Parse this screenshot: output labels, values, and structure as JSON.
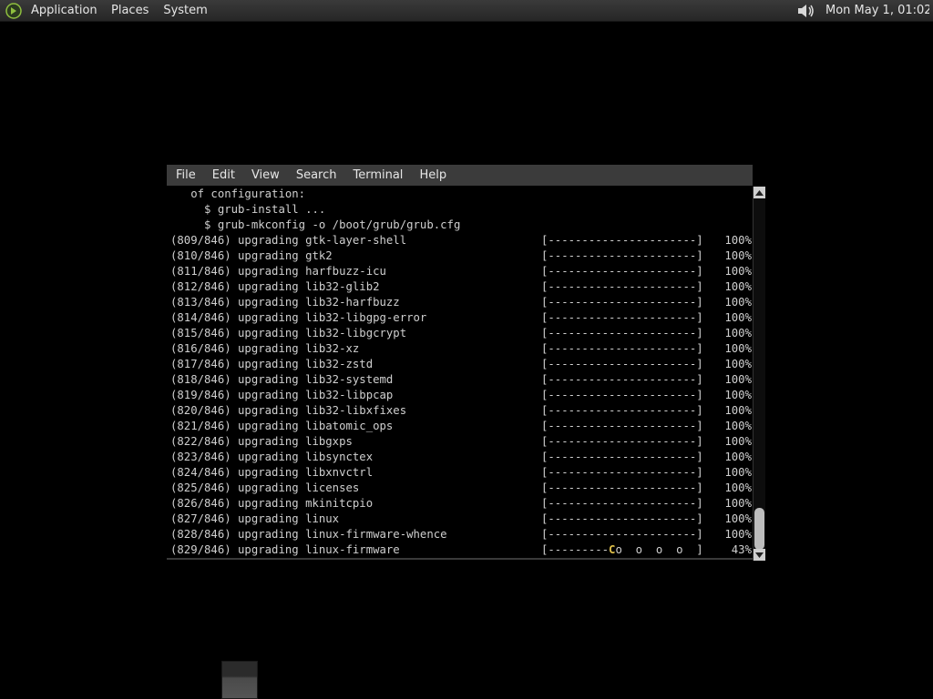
{
  "top_panel": {
    "menus": [
      "Applications",
      "Places",
      "System"
    ],
    "clock": "Mon May  1, 01:02",
    "icons": {
      "logo": "distro-logo-icon",
      "volume": "volume-icon"
    }
  },
  "terminal": {
    "menubar": [
      "File",
      "Edit",
      "View",
      "Search",
      "Terminal",
      "Help"
    ],
    "intro_lines": [
      "   of configuration:",
      "     $ grub-install ...",
      "     $ grub-mkconfig -o /boot/grub/grub.cfg"
    ],
    "full_bar": "[----------------------]",
    "rows": [
      {
        "text": "(809/846) upgrading gtk-layer-shell",
        "pct": "100%"
      },
      {
        "text": "(810/846) upgrading gtk2",
        "pct": "100%"
      },
      {
        "text": "(811/846) upgrading harfbuzz-icu",
        "pct": "100%"
      },
      {
        "text": "(812/846) upgrading lib32-glib2",
        "pct": "100%"
      },
      {
        "text": "(813/846) upgrading lib32-harfbuzz",
        "pct": "100%"
      },
      {
        "text": "(814/846) upgrading lib32-libgpg-error",
        "pct": "100%"
      },
      {
        "text": "(815/846) upgrading lib32-libgcrypt",
        "pct": "100%"
      },
      {
        "text": "(816/846) upgrading lib32-xz",
        "pct": "100%"
      },
      {
        "text": "(817/846) upgrading lib32-zstd",
        "pct": "100%"
      },
      {
        "text": "(818/846) upgrading lib32-systemd",
        "pct": "100%"
      },
      {
        "text": "(819/846) upgrading lib32-libpcap",
        "pct": "100%"
      },
      {
        "text": "(820/846) upgrading lib32-libxfixes",
        "pct": "100%"
      },
      {
        "text": "(821/846) upgrading libatomic_ops",
        "pct": "100%"
      },
      {
        "text": "(822/846) upgrading libgxps",
        "pct": "100%"
      },
      {
        "text": "(823/846) upgrading libsynctex",
        "pct": "100%"
      },
      {
        "text": "(824/846) upgrading libxnvctrl",
        "pct": "100%"
      },
      {
        "text": "(825/846) upgrading licenses",
        "pct": "100%"
      },
      {
        "text": "(826/846) upgrading mkinitcpio",
        "pct": "100%"
      },
      {
        "text": "(827/846) upgrading linux",
        "pct": "100%"
      },
      {
        "text": "(828/846) upgrading linux-firmware-whence",
        "pct": "100%"
      }
    ],
    "current": {
      "text": "(829/846) upgrading linux-firmware",
      "bar_open": "[---------",
      "pacman": "C",
      "dots": "o  o  o  o  ]",
      "pct": "43%"
    }
  }
}
